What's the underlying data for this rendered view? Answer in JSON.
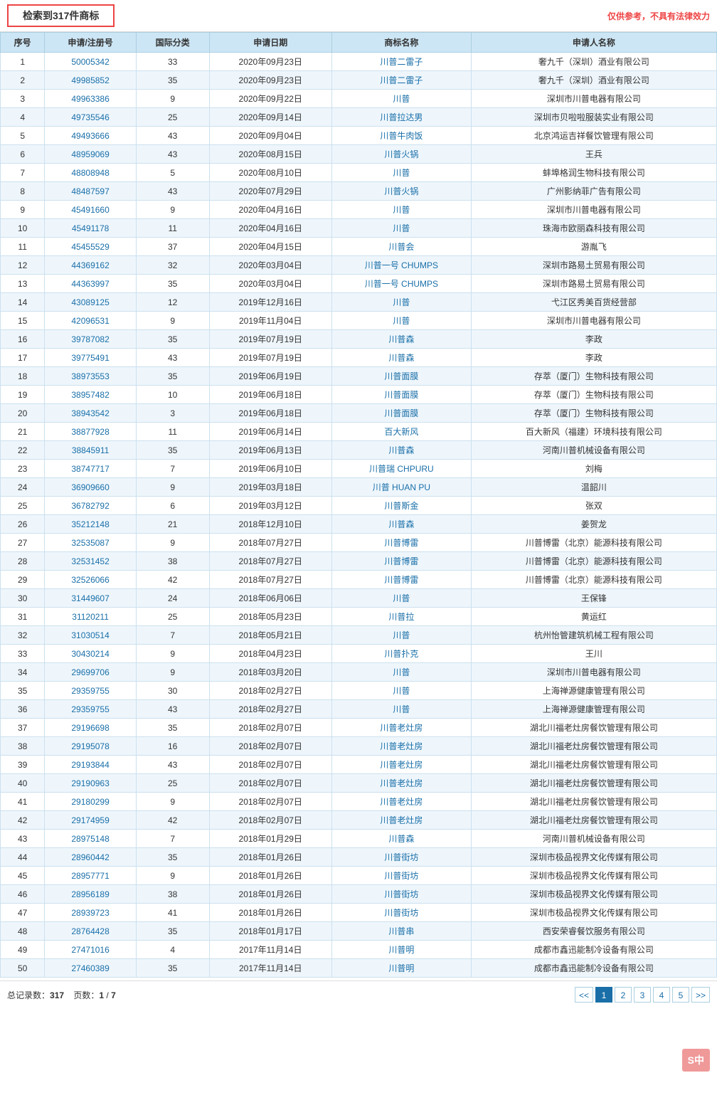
{
  "topBar": {
    "searchResult": "检索到317件商标",
    "disclaimer": "仅供参考，不具有法律效力"
  },
  "table": {
    "headers": [
      "序号",
      "申请/注册号",
      "国际分类",
      "申请日期",
      "商标名称",
      "申请人名称"
    ],
    "rows": [
      {
        "seq": "1",
        "appNo": "50005342",
        "intl": "33",
        "date": "2020年09月23日",
        "brand": "川普二雷子",
        "applicant": "奢九千（深圳）酒业有限公司"
      },
      {
        "seq": "2",
        "appNo": "49985852",
        "intl": "35",
        "date": "2020年09月23日",
        "brand": "川普二雷子",
        "applicant": "奢九千（深圳）酒业有限公司"
      },
      {
        "seq": "3",
        "appNo": "49963386",
        "intl": "9",
        "date": "2020年09月22日",
        "brand": "川普",
        "applicant": "深圳市川普电器有限公司"
      },
      {
        "seq": "4",
        "appNo": "49735546",
        "intl": "25",
        "date": "2020年09月14日",
        "brand": "川普拉达男",
        "applicant": "深圳市贝啦啦服装实业有限公司"
      },
      {
        "seq": "5",
        "appNo": "49493666",
        "intl": "43",
        "date": "2020年09月04日",
        "brand": "川普牛肉饭",
        "applicant": "北京鸿运吉祥餐饮管理有限公司"
      },
      {
        "seq": "6",
        "appNo": "48959069",
        "intl": "43",
        "date": "2020年08月15日",
        "brand": "川普火锅",
        "applicant": "王兵"
      },
      {
        "seq": "7",
        "appNo": "48808948",
        "intl": "5",
        "date": "2020年08月10日",
        "brand": "川普",
        "applicant": "蚌埠格润生物科技有限公司"
      },
      {
        "seq": "8",
        "appNo": "48487597",
        "intl": "43",
        "date": "2020年07月29日",
        "brand": "川普火锅",
        "applicant": "广州影纳菲广告有限公司"
      },
      {
        "seq": "9",
        "appNo": "45491660",
        "intl": "9",
        "date": "2020年04月16日",
        "brand": "川普",
        "applicant": "深圳市川普电器有限公司"
      },
      {
        "seq": "10",
        "appNo": "45491178",
        "intl": "11",
        "date": "2020年04月16日",
        "brand": "川普",
        "applicant": "珠海市欧丽森科技有限公司"
      },
      {
        "seq": "11",
        "appNo": "45455529",
        "intl": "37",
        "date": "2020年04月15日",
        "brand": "川普会",
        "applicant": "游胤飞"
      },
      {
        "seq": "12",
        "appNo": "44369162",
        "intl": "32",
        "date": "2020年03月04日",
        "brand": "川普一号 CHUMPS",
        "applicant": "深圳市路易土贸易有限公司"
      },
      {
        "seq": "13",
        "appNo": "44363997",
        "intl": "35",
        "date": "2020年03月04日",
        "brand": "川普一号 CHUMPS",
        "applicant": "深圳市路易土贸易有限公司"
      },
      {
        "seq": "14",
        "appNo": "43089125",
        "intl": "12",
        "date": "2019年12月16日",
        "brand": "川普",
        "applicant": "弋江区秀美百货经营部"
      },
      {
        "seq": "15",
        "appNo": "42096531",
        "intl": "9",
        "date": "2019年11月04日",
        "brand": "川普",
        "applicant": "深圳市川普电器有限公司"
      },
      {
        "seq": "16",
        "appNo": "39787082",
        "intl": "35",
        "date": "2019年07月19日",
        "brand": "川普森",
        "applicant": "李政"
      },
      {
        "seq": "17",
        "appNo": "39775491",
        "intl": "43",
        "date": "2019年07月19日",
        "brand": "川普森",
        "applicant": "李政"
      },
      {
        "seq": "18",
        "appNo": "38973553",
        "intl": "35",
        "date": "2019年06月19日",
        "brand": "川普面膜",
        "applicant": "存萃（厦门）生物科技有限公司"
      },
      {
        "seq": "19",
        "appNo": "38957482",
        "intl": "10",
        "date": "2019年06月18日",
        "brand": "川普面膜",
        "applicant": "存萃（厦门）生物科技有限公司"
      },
      {
        "seq": "20",
        "appNo": "38943542",
        "intl": "3",
        "date": "2019年06月18日",
        "brand": "川普面膜",
        "applicant": "存萃（厦门）生物科技有限公司"
      },
      {
        "seq": "21",
        "appNo": "38877928",
        "intl": "11",
        "date": "2019年06月14日",
        "brand": "百大新风",
        "applicant": "百大新风（福建）环境科技有限公司"
      },
      {
        "seq": "22",
        "appNo": "38845911",
        "intl": "35",
        "date": "2019年06月13日",
        "brand": "川普森",
        "applicant": "河南川普机械设备有限公司"
      },
      {
        "seq": "23",
        "appNo": "38747717",
        "intl": "7",
        "date": "2019年06月10日",
        "brand": "川普瑞 CHPURU",
        "applicant": "刘梅"
      },
      {
        "seq": "24",
        "appNo": "36909660",
        "intl": "9",
        "date": "2019年03月18日",
        "brand": "川普 HUAN PU",
        "applicant": "温韶川"
      },
      {
        "seq": "25",
        "appNo": "36782792",
        "intl": "6",
        "date": "2019年03月12日",
        "brand": "川普斯金",
        "applicant": "张双"
      },
      {
        "seq": "26",
        "appNo": "35212148",
        "intl": "21",
        "date": "2018年12月10日",
        "brand": "川普森",
        "applicant": "姜贺龙"
      },
      {
        "seq": "27",
        "appNo": "32535087",
        "intl": "9",
        "date": "2018年07月27日",
        "brand": "川普博雷",
        "applicant": "川普博雷（北京）能源科技有限公司"
      },
      {
        "seq": "28",
        "appNo": "32531452",
        "intl": "38",
        "date": "2018年07月27日",
        "brand": "川普博雷",
        "applicant": "川普博雷（北京）能源科技有限公司"
      },
      {
        "seq": "29",
        "appNo": "32526066",
        "intl": "42",
        "date": "2018年07月27日",
        "brand": "川普博雷",
        "applicant": "川普博雷（北京）能源科技有限公司"
      },
      {
        "seq": "30",
        "appNo": "31449607",
        "intl": "24",
        "date": "2018年06月06日",
        "brand": "川普",
        "applicant": "王保锋"
      },
      {
        "seq": "31",
        "appNo": "31120211",
        "intl": "25",
        "date": "2018年05月23日",
        "brand": "川普拉",
        "applicant": "黄运红"
      },
      {
        "seq": "32",
        "appNo": "31030514",
        "intl": "7",
        "date": "2018年05月21日",
        "brand": "川普",
        "applicant": "杭州怡管建筑机械工程有限公司"
      },
      {
        "seq": "33",
        "appNo": "30430214",
        "intl": "9",
        "date": "2018年04月23日",
        "brand": "川普扑克",
        "applicant": "王川"
      },
      {
        "seq": "34",
        "appNo": "29699706",
        "intl": "9",
        "date": "2018年03月20日",
        "brand": "川普",
        "applicant": "深圳市川普电器有限公司"
      },
      {
        "seq": "35",
        "appNo": "29359755",
        "intl": "30",
        "date": "2018年02月27日",
        "brand": "川普",
        "applicant": "上海禅源健康管理有限公司"
      },
      {
        "seq": "36",
        "appNo": "29359755",
        "intl": "43",
        "date": "2018年02月27日",
        "brand": "川普",
        "applicant": "上海禅源健康管理有限公司"
      },
      {
        "seq": "37",
        "appNo": "29196698",
        "intl": "35",
        "date": "2018年02月07日",
        "brand": "川普老灶房",
        "applicant": "湖北川福老灶房餐饮管理有限公司"
      },
      {
        "seq": "38",
        "appNo": "29195078",
        "intl": "16",
        "date": "2018年02月07日",
        "brand": "川普老灶房",
        "applicant": "湖北川福老灶房餐饮管理有限公司"
      },
      {
        "seq": "39",
        "appNo": "29193844",
        "intl": "43",
        "date": "2018年02月07日",
        "brand": "川普老灶房",
        "applicant": "湖北川福老灶房餐饮管理有限公司"
      },
      {
        "seq": "40",
        "appNo": "29190963",
        "intl": "25",
        "date": "2018年02月07日",
        "brand": "川普老灶房",
        "applicant": "湖北川福老灶房餐饮管理有限公司"
      },
      {
        "seq": "41",
        "appNo": "29180299",
        "intl": "9",
        "date": "2018年02月07日",
        "brand": "川普老灶房",
        "applicant": "湖北川福老灶房餐饮管理有限公司"
      },
      {
        "seq": "42",
        "appNo": "29174959",
        "intl": "42",
        "date": "2018年02月07日",
        "brand": "川普老灶房",
        "applicant": "湖北川福老灶房餐饮管理有限公司"
      },
      {
        "seq": "43",
        "appNo": "28975148",
        "intl": "7",
        "date": "2018年01月29日",
        "brand": "川普森",
        "applicant": "河南川普机械设备有限公司"
      },
      {
        "seq": "44",
        "appNo": "28960442",
        "intl": "35",
        "date": "2018年01月26日",
        "brand": "川普街坊",
        "applicant": "深圳市极品视界文化传媒有限公司"
      },
      {
        "seq": "45",
        "appNo": "28957771",
        "intl": "9",
        "date": "2018年01月26日",
        "brand": "川普街坊",
        "applicant": "深圳市极品视界文化传媒有限公司"
      },
      {
        "seq": "46",
        "appNo": "28956189",
        "intl": "38",
        "date": "2018年01月26日",
        "brand": "川普街坊",
        "applicant": "深圳市极品视界文化传媒有限公司"
      },
      {
        "seq": "47",
        "appNo": "28939723",
        "intl": "41",
        "date": "2018年01月26日",
        "brand": "川普街坊",
        "applicant": "深圳市极品视界文化传媒有限公司"
      },
      {
        "seq": "48",
        "appNo": "28764428",
        "intl": "35",
        "date": "2018年01月17日",
        "brand": "川普串",
        "applicant": "西安荣睿餐饮服务有限公司"
      },
      {
        "seq": "49",
        "appNo": "27471016",
        "intl": "4",
        "date": "2017年11月14日",
        "brand": "川普明",
        "applicant": "成都市鑫迅能制冷设备有限公司"
      },
      {
        "seq": "50",
        "appNo": "27460389",
        "intl": "35",
        "date": "2017年11月14日",
        "brand": "川普明",
        "applicant": "成都市鑫迅能制冷设备有限公司"
      }
    ]
  },
  "footer": {
    "totalLabel": "总记录数：",
    "total": "317",
    "pageLabel": "页数：",
    "currentPage": "1",
    "totalPages": "7"
  },
  "pagination": {
    "pages": [
      "1",
      "2",
      "3",
      "4",
      "5"
    ],
    "prev": "<<",
    "next": ">>"
  },
  "watermark": "S中"
}
